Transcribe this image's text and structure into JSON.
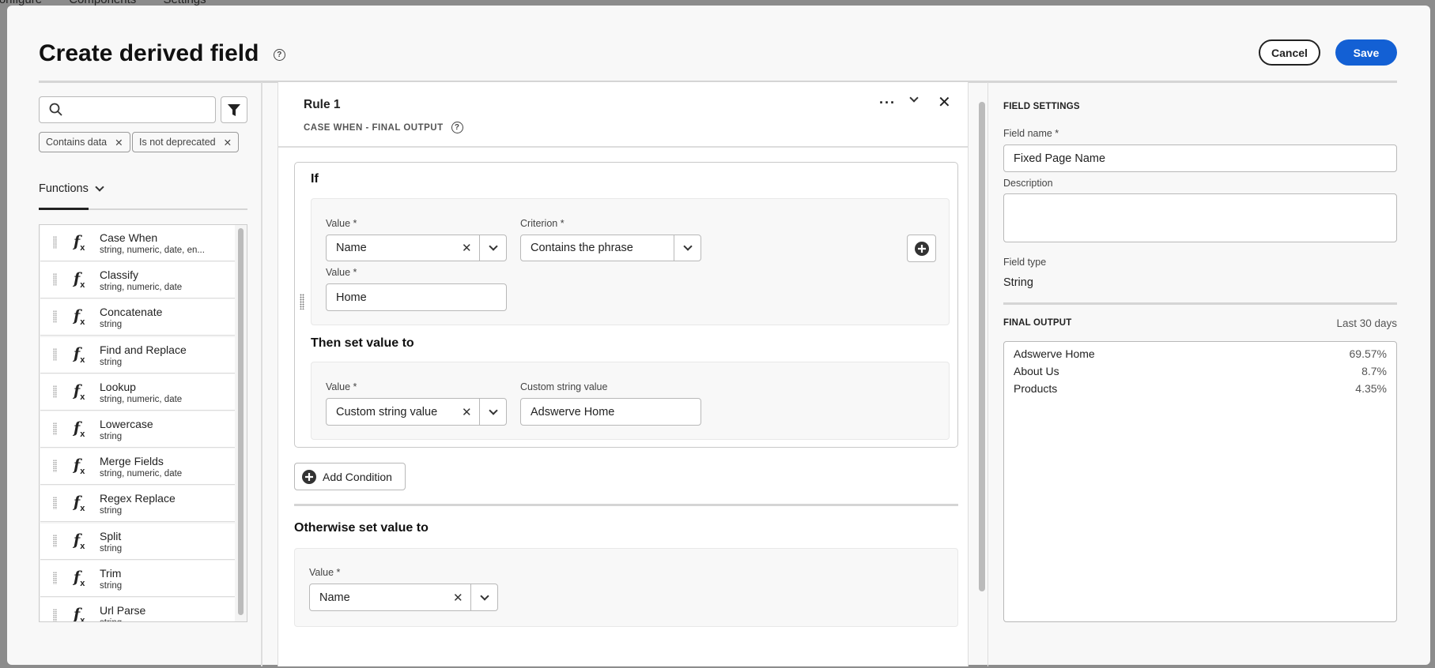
{
  "background_nav": [
    "Configure",
    "Components",
    "Settings"
  ],
  "header": {
    "title": "Create derived field",
    "cancel": "Cancel",
    "save": "Save"
  },
  "colors": {
    "accent": "#1360d4"
  },
  "left": {
    "search_placeholder": "",
    "chips": [
      "Contains data",
      "Is not deprecated"
    ],
    "functions_label": "Functions",
    "functions": [
      {
        "name": "Case When",
        "types": "string, numeric, date, en..."
      },
      {
        "name": "Classify",
        "types": "string, numeric, date"
      },
      {
        "name": "Concatenate",
        "types": "string"
      },
      {
        "name": "Find and Replace",
        "types": "string"
      },
      {
        "name": "Lookup",
        "types": "string, numeric, date"
      },
      {
        "name": "Lowercase",
        "types": "string"
      },
      {
        "name": "Merge Fields",
        "types": "string, numeric, date"
      },
      {
        "name": "Regex Replace",
        "types": "string"
      },
      {
        "name": "Split",
        "types": "string"
      },
      {
        "name": "Trim",
        "types": "string"
      },
      {
        "name": "Url Parse",
        "types": "string"
      }
    ]
  },
  "rule": {
    "title": "Rule 1",
    "subtitle": "CASE WHEN - FINAL OUTPUT",
    "if_label": "If",
    "value_label": "Value *",
    "criterion_label": "Criterion *",
    "value_select": "Name",
    "criterion_select": "Contains the phrase",
    "value2_label": "Value *",
    "value2": "Home",
    "then_label": "Then set value to",
    "then_value_label": "Value *",
    "then_value_select": "Custom string value",
    "custom_label": "Custom string value",
    "custom_value": "Adswerve Home",
    "add_condition": "Add Condition",
    "otherwise_label": "Otherwise set value to",
    "otherwise_value_label": "Value *",
    "otherwise_value_select": "Name"
  },
  "settings": {
    "section": "FIELD SETTINGS",
    "field_name_label": "Field name *",
    "field_name": "Fixed Page Name",
    "description_label": "Description",
    "description": "",
    "field_type_label": "Field type",
    "field_type": "String",
    "output_section": "FINAL OUTPUT",
    "output_range": "Last 30 days",
    "output": [
      {
        "name": "Adswerve Home",
        "pct": "69.57%"
      },
      {
        "name": "About Us",
        "pct": "8.7%"
      },
      {
        "name": "Products",
        "pct": "4.35%"
      }
    ]
  }
}
